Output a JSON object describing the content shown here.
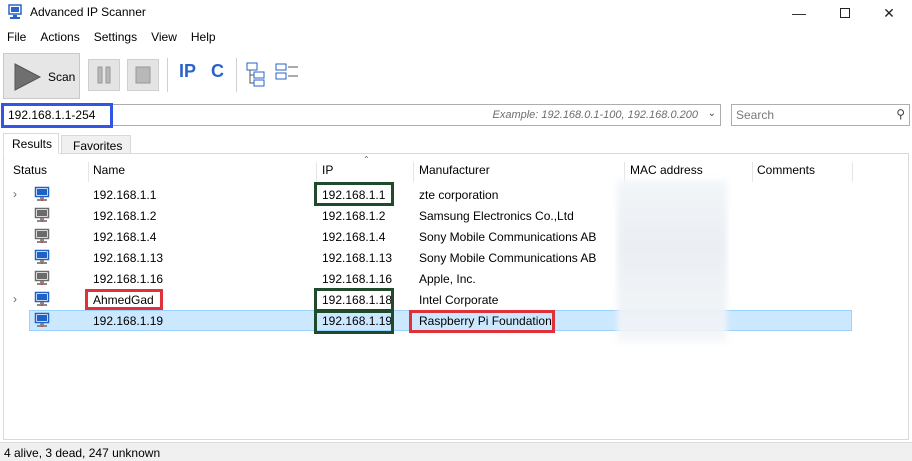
{
  "window": {
    "title": "Advanced IP Scanner"
  },
  "menu": [
    "File",
    "Actions",
    "Settings",
    "View",
    "Help"
  ],
  "toolbar": {
    "scan_label": "Scan",
    "tool_ip": "IP",
    "tool_c": "C"
  },
  "scan_range": {
    "value": "192.168.1.1-254",
    "example": "Example: 192.168.0.1-100, 192.168.0.200"
  },
  "search": {
    "placeholder": "Search"
  },
  "tabs": [
    "Results",
    "Favorites"
  ],
  "columns": [
    "Status",
    "Name",
    "IP",
    "Manufacturer",
    "MAC address",
    "Comments"
  ],
  "rows": [
    {
      "name": "192.168.1.1",
      "ip": "192.168.1.1",
      "manufacturer": "zte corporation",
      "expandable": true,
      "status": "alive"
    },
    {
      "name": "192.168.1.2",
      "ip": "192.168.1.2",
      "manufacturer": "Samsung Electronics Co.,Ltd",
      "expandable": false,
      "status": "dead"
    },
    {
      "name": "192.168.1.4",
      "ip": "192.168.1.4",
      "manufacturer": "Sony Mobile Communications AB",
      "expandable": false,
      "status": "dead"
    },
    {
      "name": "192.168.1.13",
      "ip": "192.168.1.13",
      "manufacturer": "Sony Mobile Communications AB",
      "expandable": false,
      "status": "alive"
    },
    {
      "name": "192.168.1.16",
      "ip": "192.168.1.16",
      "manufacturer": "Apple, Inc.",
      "expandable": false,
      "status": "dead"
    },
    {
      "name": "AhmedGad",
      "ip": "192.168.1.18",
      "manufacturer": "Intel Corporate",
      "expandable": true,
      "status": "alive"
    },
    {
      "name": "192.168.1.19",
      "ip": "192.168.1.19",
      "manufacturer": "Raspberry Pi Foundation",
      "expandable": false,
      "status": "alive"
    }
  ],
  "statusbar": {
    "text": "4 alive, 3 dead, 247 unknown"
  },
  "colors": {
    "selection": "#cce8ff",
    "highlight_blue": "#3355e6",
    "highlight_red": "#e0313b",
    "highlight_green": "#1f4a2c",
    "icon_alive": "#1e62c8",
    "icon_dead": "#6b6b6b"
  }
}
